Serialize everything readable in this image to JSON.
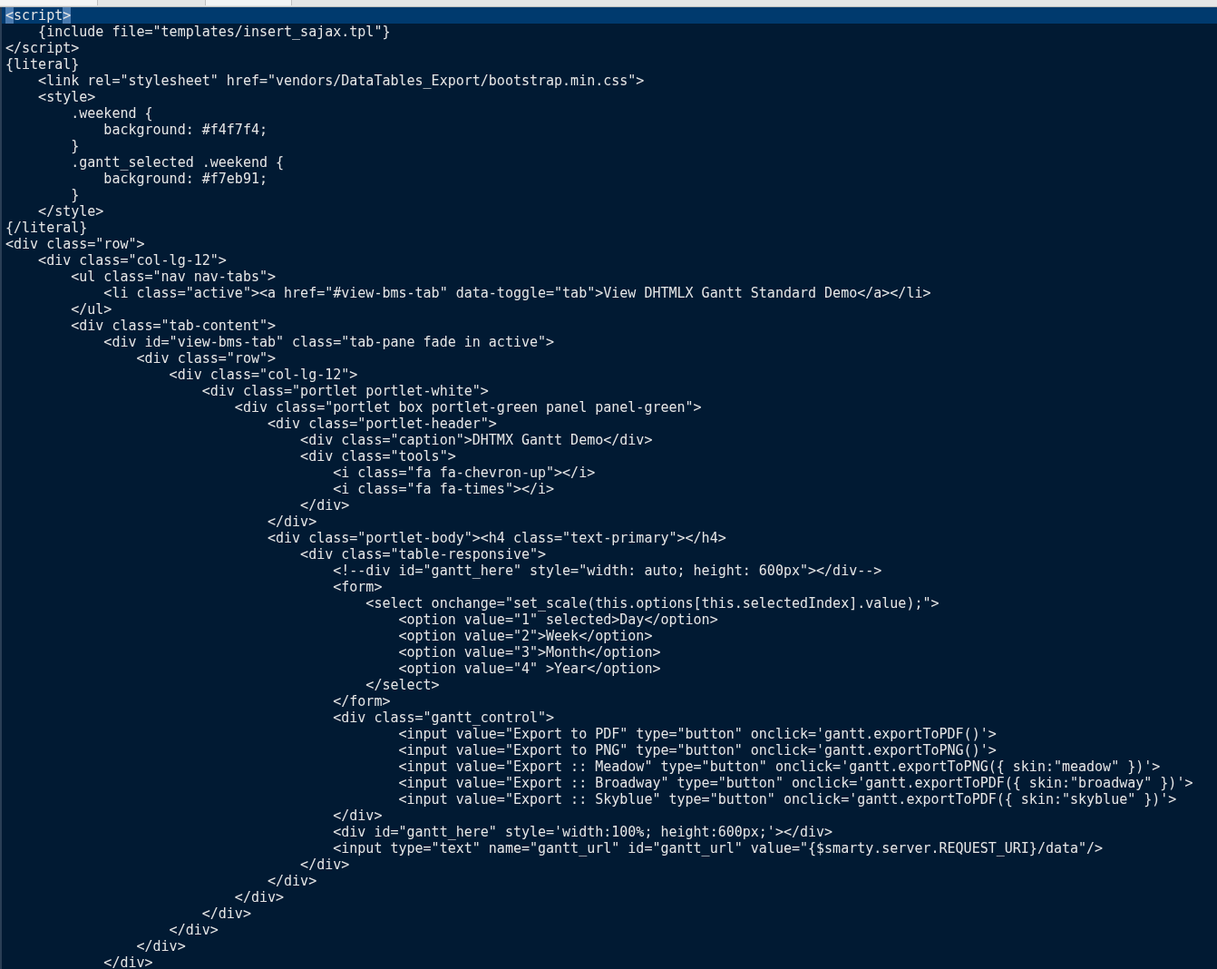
{
  "editor": {
    "lines": [
      {
        "current": true,
        "segments": [
          {
            "text": "<",
            "matched": true
          },
          {
            "text": "script",
            "matched": false
          },
          {
            "text": ">",
            "matched": true
          }
        ]
      },
      {
        "current": false,
        "text": "    {include file=\"templates/insert_sajax.tpl\"}"
      },
      {
        "current": false,
        "text": "</script>"
      },
      {
        "current": false,
        "text": "{literal}"
      },
      {
        "current": false,
        "text": "    <link rel=\"stylesheet\" href=\"vendors/DataTables_Export/bootstrap.min.css\">"
      },
      {
        "current": false,
        "text": "    <style>"
      },
      {
        "current": false,
        "text": "        .weekend {"
      },
      {
        "current": false,
        "text": "            background: #f4f7f4;"
      },
      {
        "current": false,
        "text": "        }"
      },
      {
        "current": false,
        "text": "        .gantt_selected .weekend {"
      },
      {
        "current": false,
        "text": "            background: #f7eb91;"
      },
      {
        "current": false,
        "text": "        }"
      },
      {
        "current": false,
        "text": "    </style>"
      },
      {
        "current": false,
        "text": "{/literal}"
      },
      {
        "current": false,
        "text": "<div class=\"row\">"
      },
      {
        "current": false,
        "text": "    <div class=\"col-lg-12\">"
      },
      {
        "current": false,
        "text": "        <ul class=\"nav nav-tabs\">"
      },
      {
        "current": false,
        "text": "            <li class=\"active\"><a href=\"#view-bms-tab\" data-toggle=\"tab\">View DHTMLX Gantt Standard Demo</a></li>"
      },
      {
        "current": false,
        "text": "        </ul>"
      },
      {
        "current": false,
        "text": "        <div class=\"tab-content\">"
      },
      {
        "current": false,
        "text": "            <div id=\"view-bms-tab\" class=\"tab-pane fade in active\">"
      },
      {
        "current": false,
        "text": "                <div class=\"row\">"
      },
      {
        "current": false,
        "text": "                    <div class=\"col-lg-12\">"
      },
      {
        "current": false,
        "text": "                        <div class=\"portlet portlet-white\">"
      },
      {
        "current": false,
        "text": "                            <div class=\"portlet box portlet-green panel panel-green\">"
      },
      {
        "current": false,
        "text": "                                <div class=\"portlet-header\">"
      },
      {
        "current": false,
        "text": "                                    <div class=\"caption\">DHTMX Gantt Demo</div>"
      },
      {
        "current": false,
        "text": "                                    <div class=\"tools\">"
      },
      {
        "current": false,
        "text": "                                        <i class=\"fa fa-chevron-up\"></i>"
      },
      {
        "current": false,
        "text": "                                        <i class=\"fa fa-times\"></i>"
      },
      {
        "current": false,
        "text": "                                    </div>"
      },
      {
        "current": false,
        "text": "                                </div>"
      },
      {
        "current": false,
        "text": "                                <div class=\"portlet-body\"><h4 class=\"text-primary\"></h4>"
      },
      {
        "current": false,
        "text": "                                    <div class=\"table-responsive\">"
      },
      {
        "current": false,
        "text": "                                        <!--div id=\"gantt_here\" style=\"width: auto; height: 600px\"></div-->"
      },
      {
        "current": false,
        "text": "                                        <form>"
      },
      {
        "current": false,
        "text": "                                            <select onchange=\"set_scale(this.options[this.selectedIndex].value);\">"
      },
      {
        "current": false,
        "text": "                                                <option value=\"1\" selected>Day</option>"
      },
      {
        "current": false,
        "text": "                                                <option value=\"2\">Week</option>"
      },
      {
        "current": false,
        "text": "                                                <option value=\"3\">Month</option>"
      },
      {
        "current": false,
        "text": "                                                <option value=\"4\" >Year</option>"
      },
      {
        "current": false,
        "text": "                                            </select>"
      },
      {
        "current": false,
        "text": "                                        </form>"
      },
      {
        "current": false,
        "text": "                                        <div class=\"gantt_control\">"
      },
      {
        "current": false,
        "text": "                                                <input value=\"Export to PDF\" type=\"button\" onclick='gantt.exportToPDF()'>"
      },
      {
        "current": false,
        "text": "                                                <input value=\"Export to PNG\" type=\"button\" onclick='gantt.exportToPNG()'>"
      },
      {
        "current": false,
        "text": "                                                <input value=\"Export :: Meadow\" type=\"button\" onclick='gantt.exportToPNG({ skin:\"meadow\" })'>"
      },
      {
        "current": false,
        "text": "                                                <input value=\"Export :: Broadway\" type=\"button\" onclick='gantt.exportToPDF({ skin:\"broadway\" })'>"
      },
      {
        "current": false,
        "text": "                                                <input value=\"Export :: Skyblue\" type=\"button\" onclick='gantt.exportToPDF({ skin:\"skyblue\" })'>"
      },
      {
        "current": false,
        "text": "                                        </div>"
      },
      {
        "current": false,
        "text": "                                        <div id=\"gantt_here\" style='width:100%; height:600px;'></div>"
      },
      {
        "current": false,
        "text": "                                        <input type=\"text\" name=\"gantt_url\" id=\"gantt_url\" value=\"{$smarty.server.REQUEST_URI}/data\"/>"
      },
      {
        "current": false,
        "text": "                                    </div>"
      },
      {
        "current": false,
        "text": "                                </div>"
      },
      {
        "current": false,
        "text": "                            </div>"
      },
      {
        "current": false,
        "text": "                        </div>"
      },
      {
        "current": false,
        "text": "                    </div>"
      },
      {
        "current": false,
        "text": "                </div>"
      },
      {
        "current": false,
        "text": "            </div>"
      }
    ]
  }
}
